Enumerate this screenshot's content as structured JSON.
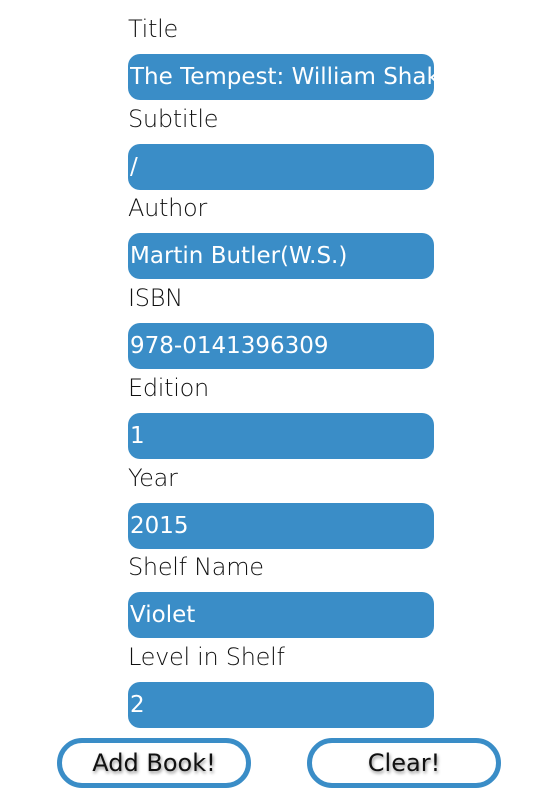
{
  "fields": [
    {
      "label": "Title",
      "value": "The Tempest: William Shakespeare"
    },
    {
      "label": "Subtitle",
      "value": "/"
    },
    {
      "label": "Author",
      "value": "Martin Butler(W.S.)"
    },
    {
      "label": "ISBN",
      "value": "978-0141396309"
    },
    {
      "label": "Edition",
      "value": "1"
    },
    {
      "label": "Year",
      "value": "2015"
    },
    {
      "label": "Shelf Name",
      "value": "Violet"
    },
    {
      "label": "Level in Shelf",
      "value": "2"
    }
  ],
  "buttons": {
    "add_label": "Add Book!",
    "clear_label": "Clear!"
  },
  "colors": {
    "field_background": "#3a8dc7",
    "field_text": "#ffffff",
    "button_border": "#3a8dc7"
  }
}
